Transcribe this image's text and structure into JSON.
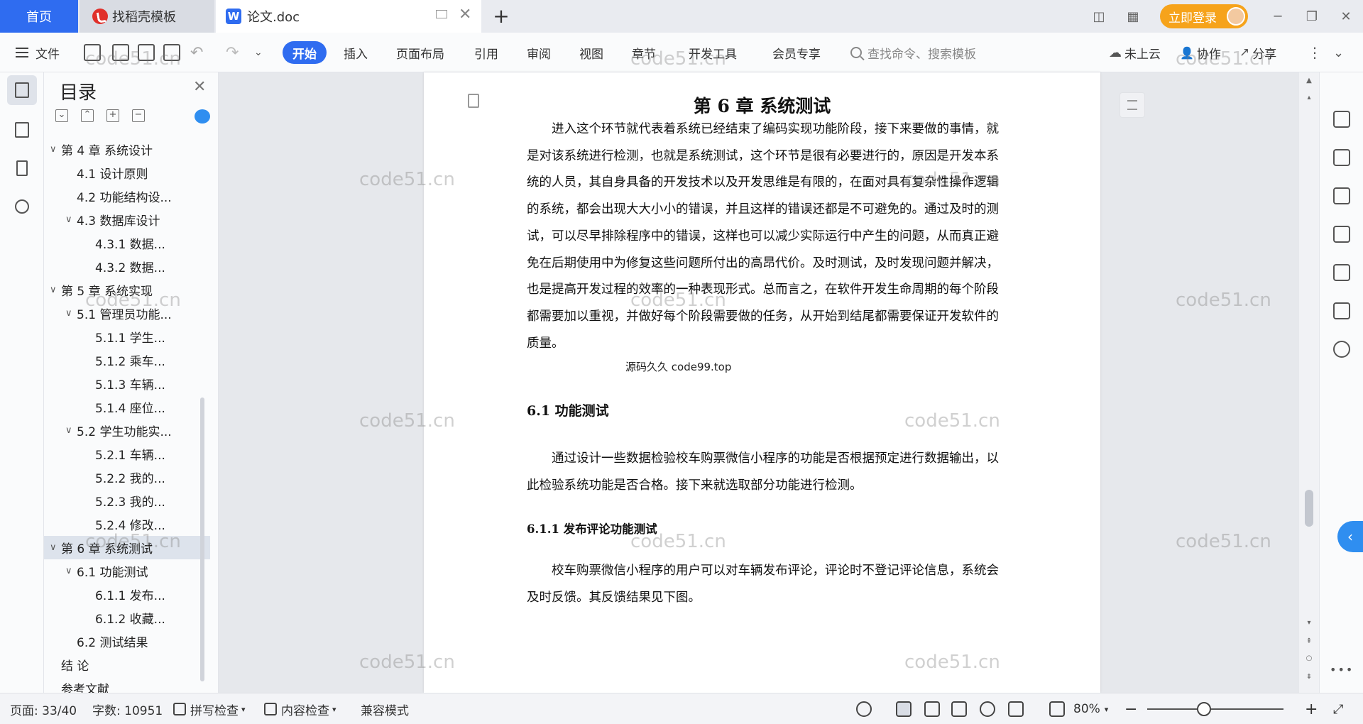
{
  "tabs": {
    "home": "首页",
    "template": "找稻壳模板",
    "doc": "论文.doc"
  },
  "titlebar": {
    "login": "立即登录"
  },
  "toolbar": {
    "file": "文件",
    "ribbon_tabs": [
      "开始",
      "插入",
      "页面布局",
      "引用",
      "审阅",
      "视图",
      "章节",
      "开发工具",
      "会员专享"
    ],
    "search_placeholder": "查找命令、搜索模板",
    "cloud": "未上云",
    "collab": "协作",
    "share": "分享"
  },
  "toc": {
    "title": "目录",
    "items": [
      {
        "label": "第 4 章  系统设计",
        "level": 1,
        "caret": true
      },
      {
        "label": "4.1  设计原则",
        "level": 2,
        "caret": false
      },
      {
        "label": "4.2  功能结构设...",
        "level": 2,
        "caret": false
      },
      {
        "label": "4.3  数据库设计",
        "level": 2,
        "caret": true
      },
      {
        "label": "4.3.1  数据...",
        "level": 3,
        "caret": false
      },
      {
        "label": "4.3.2  数据...",
        "level": 3,
        "caret": false
      },
      {
        "label": "第 5 章  系统实现",
        "level": 1,
        "caret": true
      },
      {
        "label": "5.1  管理员功能...",
        "level": 2,
        "caret": true
      },
      {
        "label": "5.1.1  学生...",
        "level": 3,
        "caret": false
      },
      {
        "label": "5.1.2  乘车...",
        "level": 3,
        "caret": false
      },
      {
        "label": "5.1.3  车辆...",
        "level": 3,
        "caret": false
      },
      {
        "label": "5.1.4  座位...",
        "level": 3,
        "caret": false
      },
      {
        "label": "5.2  学生功能实...",
        "level": 2,
        "caret": true
      },
      {
        "label": "5.2.1  车辆...",
        "level": 3,
        "caret": false
      },
      {
        "label": "5.2.2  我的...",
        "level": 3,
        "caret": false
      },
      {
        "label": "5.2.3  我的...",
        "level": 3,
        "caret": false
      },
      {
        "label": "5.2.4  修改...",
        "level": 3,
        "caret": false
      },
      {
        "label": "第 6 章  系统测试",
        "level": 1,
        "caret": true,
        "active": true
      },
      {
        "label": "6.1  功能测试",
        "level": 2,
        "caret": true
      },
      {
        "label": "6.1.1  发布...",
        "level": 3,
        "caret": false
      },
      {
        "label": "6.1.2  收藏...",
        "level": 3,
        "caret": false
      },
      {
        "label": "6.2  测试结果",
        "level": 2,
        "caret": false
      },
      {
        "label": "结   论",
        "level": 1,
        "caret": false
      },
      {
        "label": "参考文献",
        "level": 1,
        "caret": false
      }
    ]
  },
  "document": {
    "chapter_title": "第 6 章  系统测试",
    "para1": "进入这个环节就代表着系统已经结束了编码实现功能阶段，接下来要做的事情，就是对该系统进行检测，也就是系统测试，这个环节是很有必要进行的，原因是开发本系统的人员，其自身具备的开发技术以及开发思维是有限的，在面对具有复杂性操作逻辑的系统，都会出现大大小小的错误，并且这样的错误还都是不可避免的。通过及时的测试，可以尽早排除程序中的错误，这样也可以减少实际运行中产生的问题，从而真正避免在后期使用中为修复这些问题所付出的高昂代价。及时测试，及时发现问题并解决，也是提高开发过程的效率的一种表现形式。总而言之，在软件开发生命周期的每个阶段都需要加以重视，并做好每个阶段需要做的任务，从开始到结尾都需要保证开发软件的质量。",
    "source_note": "源码久久 code99.top",
    "h_61": "6.1  功能测试",
    "para2": "通过设计一些数据检验校车购票微信小程序的功能是否根据预定进行数据输出，以此检验系统功能是否合格。接下来就选取部分功能进行检测。",
    "h_611": "6.1.1  发布评论功能测试",
    "para3": "校车购票微信小程序的用户可以对车辆发布评论，评论时不登记评论信息，系统会及时反馈。其反馈结果见下图。"
  },
  "watermark": "code51.cn",
  "statusbar": {
    "page": "页面: 33/40",
    "words": "字数: 10951",
    "spell": "拼写检查",
    "content_check": "内容检查",
    "compat": "兼容模式",
    "zoom": "80%"
  },
  "colors": {
    "accent": "#2f6cf0",
    "login": "#f6a31b"
  }
}
